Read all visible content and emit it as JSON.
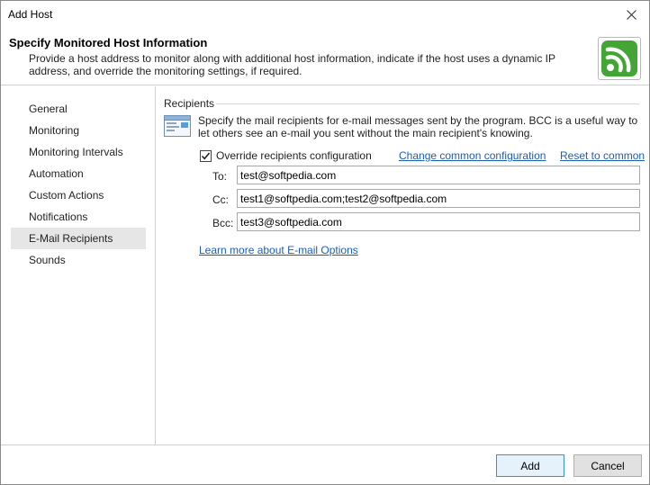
{
  "window": {
    "title": "Add Host"
  },
  "header": {
    "title": "Specify Monitored Host Information",
    "description": "Provide a host address to monitor along with additional host information, indicate if the host uses a dynamic IP address, and override the monitoring settings, if required."
  },
  "sidebar": {
    "items": [
      {
        "label": "General"
      },
      {
        "label": "Monitoring"
      },
      {
        "label": "Monitoring Intervals"
      },
      {
        "label": "Automation"
      },
      {
        "label": "Custom Actions"
      },
      {
        "label": "Notifications"
      },
      {
        "label": "E-Mail Recipients"
      },
      {
        "label": "Sounds"
      }
    ],
    "selected": "E-Mail Recipients"
  },
  "recipients": {
    "group_label": "Recipients",
    "description": "Specify the mail recipients for e-mail messages sent by the program. BCC is a useful way to let others see an e-mail you sent without the main recipient's knowing.",
    "override_label": "Override recipients configuration",
    "override_checked": true,
    "change_common_link": "Change common configuration",
    "reset_link": "Reset to common",
    "to_label": "To:",
    "to_value": "test@softpedia.com",
    "cc_label": "Cc:",
    "cc_value": "test1@softpedia.com;test2@softpedia.com",
    "bcc_label": "Bcc:",
    "bcc_value": "test3@softpedia.com",
    "learn_more_link": "Learn more about E-mail Options"
  },
  "footer": {
    "add_label": "Add",
    "cancel_label": "Cancel"
  },
  "colors": {
    "accent": "#1a5fb4",
    "logo_green": "#43a535",
    "selected_bg": "#e6e6e6"
  }
}
